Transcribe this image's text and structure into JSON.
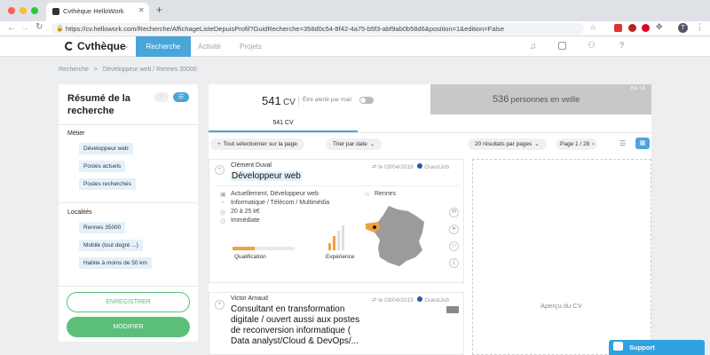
{
  "browser": {
    "tab_title": "Cvthèque HelloWork",
    "url": "https://cv.hellowork.com/Recherche/AffichageListeDepuisProfil?GuidRecherche=358d0c54-8f42-4a75-b5f3-abf9ab0b58d6&position=1&edition=False",
    "avatar_letter": "T"
  },
  "app": {
    "logo": "Cvthèque",
    "nav": {
      "recherche": "Recherche",
      "activite": "Activité",
      "projets": "Projets"
    }
  },
  "breadcrumb": {
    "root": "Recherche",
    "sep": ">",
    "current": "Développeur web / Rennes 35000"
  },
  "summary": {
    "title": "Résumé de la recherche",
    "metier_label": "Métier",
    "metier_tags": [
      "Développeur web",
      "Postes actuels",
      "Postes recherchés"
    ],
    "localites_label": "Localités",
    "localites_tags": [
      "Rennes 35000",
      "Mobile (tout degré ...)",
      "Habite à moins de 50 km"
    ],
    "btn_save": "ENREGISTRER",
    "btn_modify": "MODIFIER"
  },
  "results": {
    "count": "541",
    "count_unit": "CV",
    "alert_label": "Être alerté par mail",
    "veille_count": "536",
    "veille_label": "personnes en veille",
    "beta": "BETA",
    "tab_label": "541 CV",
    "select_all": "Tout sélectionner sur la page",
    "sort": "Trier par date",
    "per_page": "20 résultats par pages",
    "page": "Page 1 / 28",
    "preview_label": "Aperçu du CV"
  },
  "cards": [
    {
      "name": "Clément Duval",
      "title": "Développeur web",
      "date": "le 03/04/2019",
      "source": "OuestJob",
      "current": "Actuellement, Développeur web",
      "sector": "Informatique / Télécom / Multimédia",
      "salary": "20 à 25 k€",
      "availability": "Immédiate",
      "location": "Rennes",
      "qualification_label": "Qualification",
      "qualification_level": 0.35,
      "experience_label": "Expérience",
      "experience_level": 0.5
    },
    {
      "name": "Victor Arnaud",
      "title": "Consultant en transformation digitale / ouvert aussi aux postes de reconversion informatique ( Data analyst/Cloud & DevOps/...",
      "date": "le 03/04/2019",
      "source": "OuestJob"
    }
  ],
  "support": "Support",
  "colors": {
    "accent": "#4aa6d8",
    "green": "#5bbf7a",
    "orange": "#f0a23a",
    "map_grey": "#9b9b9b"
  }
}
